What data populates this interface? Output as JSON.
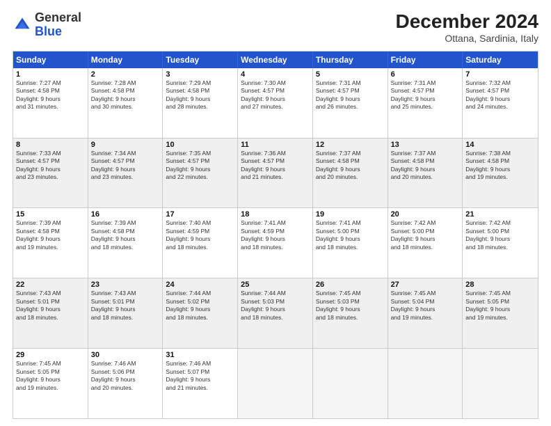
{
  "header": {
    "logo_general": "General",
    "logo_blue": "Blue",
    "month_title": "December 2024",
    "location": "Ottana, Sardinia, Italy"
  },
  "days_of_week": [
    "Sunday",
    "Monday",
    "Tuesday",
    "Wednesday",
    "Thursday",
    "Friday",
    "Saturday"
  ],
  "rows": [
    [
      {
        "day": "1",
        "text": "Sunrise: 7:27 AM\nSunset: 4:58 PM\nDaylight: 9 hours\nand 31 minutes."
      },
      {
        "day": "2",
        "text": "Sunrise: 7:28 AM\nSunset: 4:58 PM\nDaylight: 9 hours\nand 30 minutes."
      },
      {
        "day": "3",
        "text": "Sunrise: 7:29 AM\nSunset: 4:58 PM\nDaylight: 9 hours\nand 28 minutes."
      },
      {
        "day": "4",
        "text": "Sunrise: 7:30 AM\nSunset: 4:57 PM\nDaylight: 9 hours\nand 27 minutes."
      },
      {
        "day": "5",
        "text": "Sunrise: 7:31 AM\nSunset: 4:57 PM\nDaylight: 9 hours\nand 26 minutes."
      },
      {
        "day": "6",
        "text": "Sunrise: 7:31 AM\nSunset: 4:57 PM\nDaylight: 9 hours\nand 25 minutes."
      },
      {
        "day": "7",
        "text": "Sunrise: 7:32 AM\nSunset: 4:57 PM\nDaylight: 9 hours\nand 24 minutes."
      }
    ],
    [
      {
        "day": "8",
        "text": "Sunrise: 7:33 AM\nSunset: 4:57 PM\nDaylight: 9 hours\nand 23 minutes.",
        "shaded": true
      },
      {
        "day": "9",
        "text": "Sunrise: 7:34 AM\nSunset: 4:57 PM\nDaylight: 9 hours\nand 23 minutes.",
        "shaded": true
      },
      {
        "day": "10",
        "text": "Sunrise: 7:35 AM\nSunset: 4:57 PM\nDaylight: 9 hours\nand 22 minutes.",
        "shaded": true
      },
      {
        "day": "11",
        "text": "Sunrise: 7:36 AM\nSunset: 4:57 PM\nDaylight: 9 hours\nand 21 minutes.",
        "shaded": true
      },
      {
        "day": "12",
        "text": "Sunrise: 7:37 AM\nSunset: 4:58 PM\nDaylight: 9 hours\nand 20 minutes.",
        "shaded": true
      },
      {
        "day": "13",
        "text": "Sunrise: 7:37 AM\nSunset: 4:58 PM\nDaylight: 9 hours\nand 20 minutes.",
        "shaded": true
      },
      {
        "day": "14",
        "text": "Sunrise: 7:38 AM\nSunset: 4:58 PM\nDaylight: 9 hours\nand 19 minutes.",
        "shaded": true
      }
    ],
    [
      {
        "day": "15",
        "text": "Sunrise: 7:39 AM\nSunset: 4:58 PM\nDaylight: 9 hours\nand 19 minutes."
      },
      {
        "day": "16",
        "text": "Sunrise: 7:39 AM\nSunset: 4:58 PM\nDaylight: 9 hours\nand 18 minutes."
      },
      {
        "day": "17",
        "text": "Sunrise: 7:40 AM\nSunset: 4:59 PM\nDaylight: 9 hours\nand 18 minutes."
      },
      {
        "day": "18",
        "text": "Sunrise: 7:41 AM\nSunset: 4:59 PM\nDaylight: 9 hours\nand 18 minutes."
      },
      {
        "day": "19",
        "text": "Sunrise: 7:41 AM\nSunset: 5:00 PM\nDaylight: 9 hours\nand 18 minutes."
      },
      {
        "day": "20",
        "text": "Sunrise: 7:42 AM\nSunset: 5:00 PM\nDaylight: 9 hours\nand 18 minutes."
      },
      {
        "day": "21",
        "text": "Sunrise: 7:42 AM\nSunset: 5:00 PM\nDaylight: 9 hours\nand 18 minutes."
      }
    ],
    [
      {
        "day": "22",
        "text": "Sunrise: 7:43 AM\nSunset: 5:01 PM\nDaylight: 9 hours\nand 18 minutes.",
        "shaded": true
      },
      {
        "day": "23",
        "text": "Sunrise: 7:43 AM\nSunset: 5:01 PM\nDaylight: 9 hours\nand 18 minutes.",
        "shaded": true
      },
      {
        "day": "24",
        "text": "Sunrise: 7:44 AM\nSunset: 5:02 PM\nDaylight: 9 hours\nand 18 minutes.",
        "shaded": true
      },
      {
        "day": "25",
        "text": "Sunrise: 7:44 AM\nSunset: 5:03 PM\nDaylight: 9 hours\nand 18 minutes.",
        "shaded": true
      },
      {
        "day": "26",
        "text": "Sunrise: 7:45 AM\nSunset: 5:03 PM\nDaylight: 9 hours\nand 18 minutes.",
        "shaded": true
      },
      {
        "day": "27",
        "text": "Sunrise: 7:45 AM\nSunset: 5:04 PM\nDaylight: 9 hours\nand 19 minutes.",
        "shaded": true
      },
      {
        "day": "28",
        "text": "Sunrise: 7:45 AM\nSunset: 5:05 PM\nDaylight: 9 hours\nand 19 minutes.",
        "shaded": true
      }
    ],
    [
      {
        "day": "29",
        "text": "Sunrise: 7:45 AM\nSunset: 5:05 PM\nDaylight: 9 hours\nand 19 minutes."
      },
      {
        "day": "30",
        "text": "Sunrise: 7:46 AM\nSunset: 5:06 PM\nDaylight: 9 hours\nand 20 minutes."
      },
      {
        "day": "31",
        "text": "Sunrise: 7:46 AM\nSunset: 5:07 PM\nDaylight: 9 hours\nand 21 minutes."
      },
      {
        "day": "",
        "text": "",
        "empty": true
      },
      {
        "day": "",
        "text": "",
        "empty": true
      },
      {
        "day": "",
        "text": "",
        "empty": true
      },
      {
        "day": "",
        "text": "",
        "empty": true
      }
    ]
  ]
}
